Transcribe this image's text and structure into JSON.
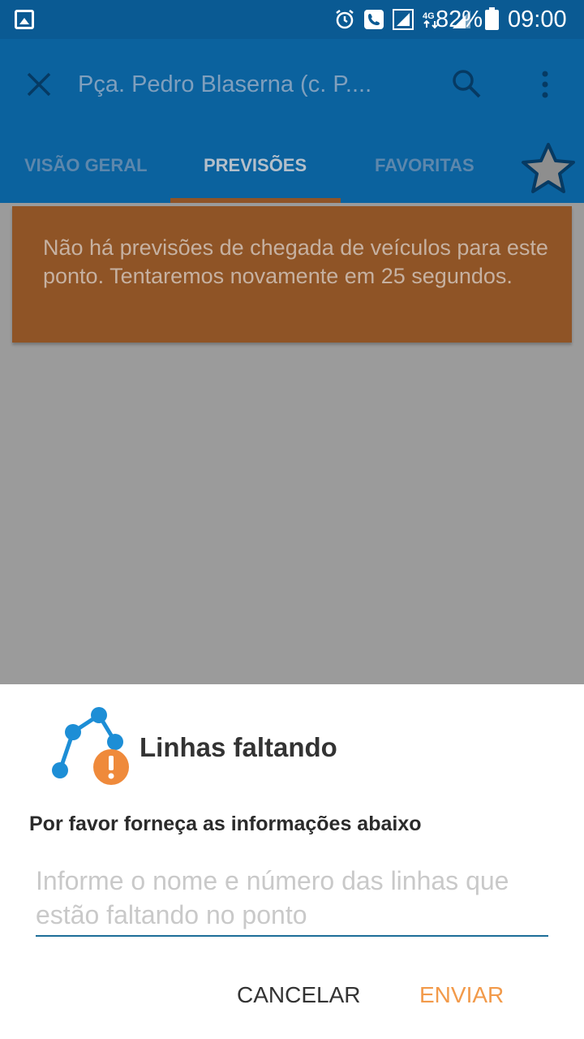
{
  "status_bar": {
    "battery_percent": "82%",
    "clock": "09:00",
    "network": "4G",
    "icons": [
      "gallery-icon",
      "alarm-icon",
      "call-icon",
      "signal-icon",
      "4g-icon",
      "signal-icon",
      "battery-icon"
    ]
  },
  "appbar": {
    "title": "Pça. Pedro Blaserna (c. P....",
    "icons": [
      "close-icon",
      "search-icon",
      "more-vert-icon",
      "star-icon"
    ]
  },
  "tabs": [
    {
      "label": "VISÃO GERAL"
    },
    {
      "label": "PREVISÕES"
    },
    {
      "label": "FAVORITAS"
    }
  ],
  "message": {
    "text": "Não há previsões de chegada de veículos para este ponto. Tentaremos novamente em 25 segundos."
  },
  "dialog": {
    "title": "Linhas faltando",
    "subtitle": "Por favor forneça as informações abaixo",
    "field_placeholder": "Informe o nome e número das linhas que estão faltando no ponto",
    "field_value": "",
    "cancel_label": "CANCELAR",
    "send_label": "ENVIAR"
  },
  "colors": {
    "status_bar": "#0a5a93",
    "appbar": "#0b629e",
    "card": "#8f5426",
    "accent": "#f29a4a",
    "line_blue": "#1d8ed6"
  }
}
